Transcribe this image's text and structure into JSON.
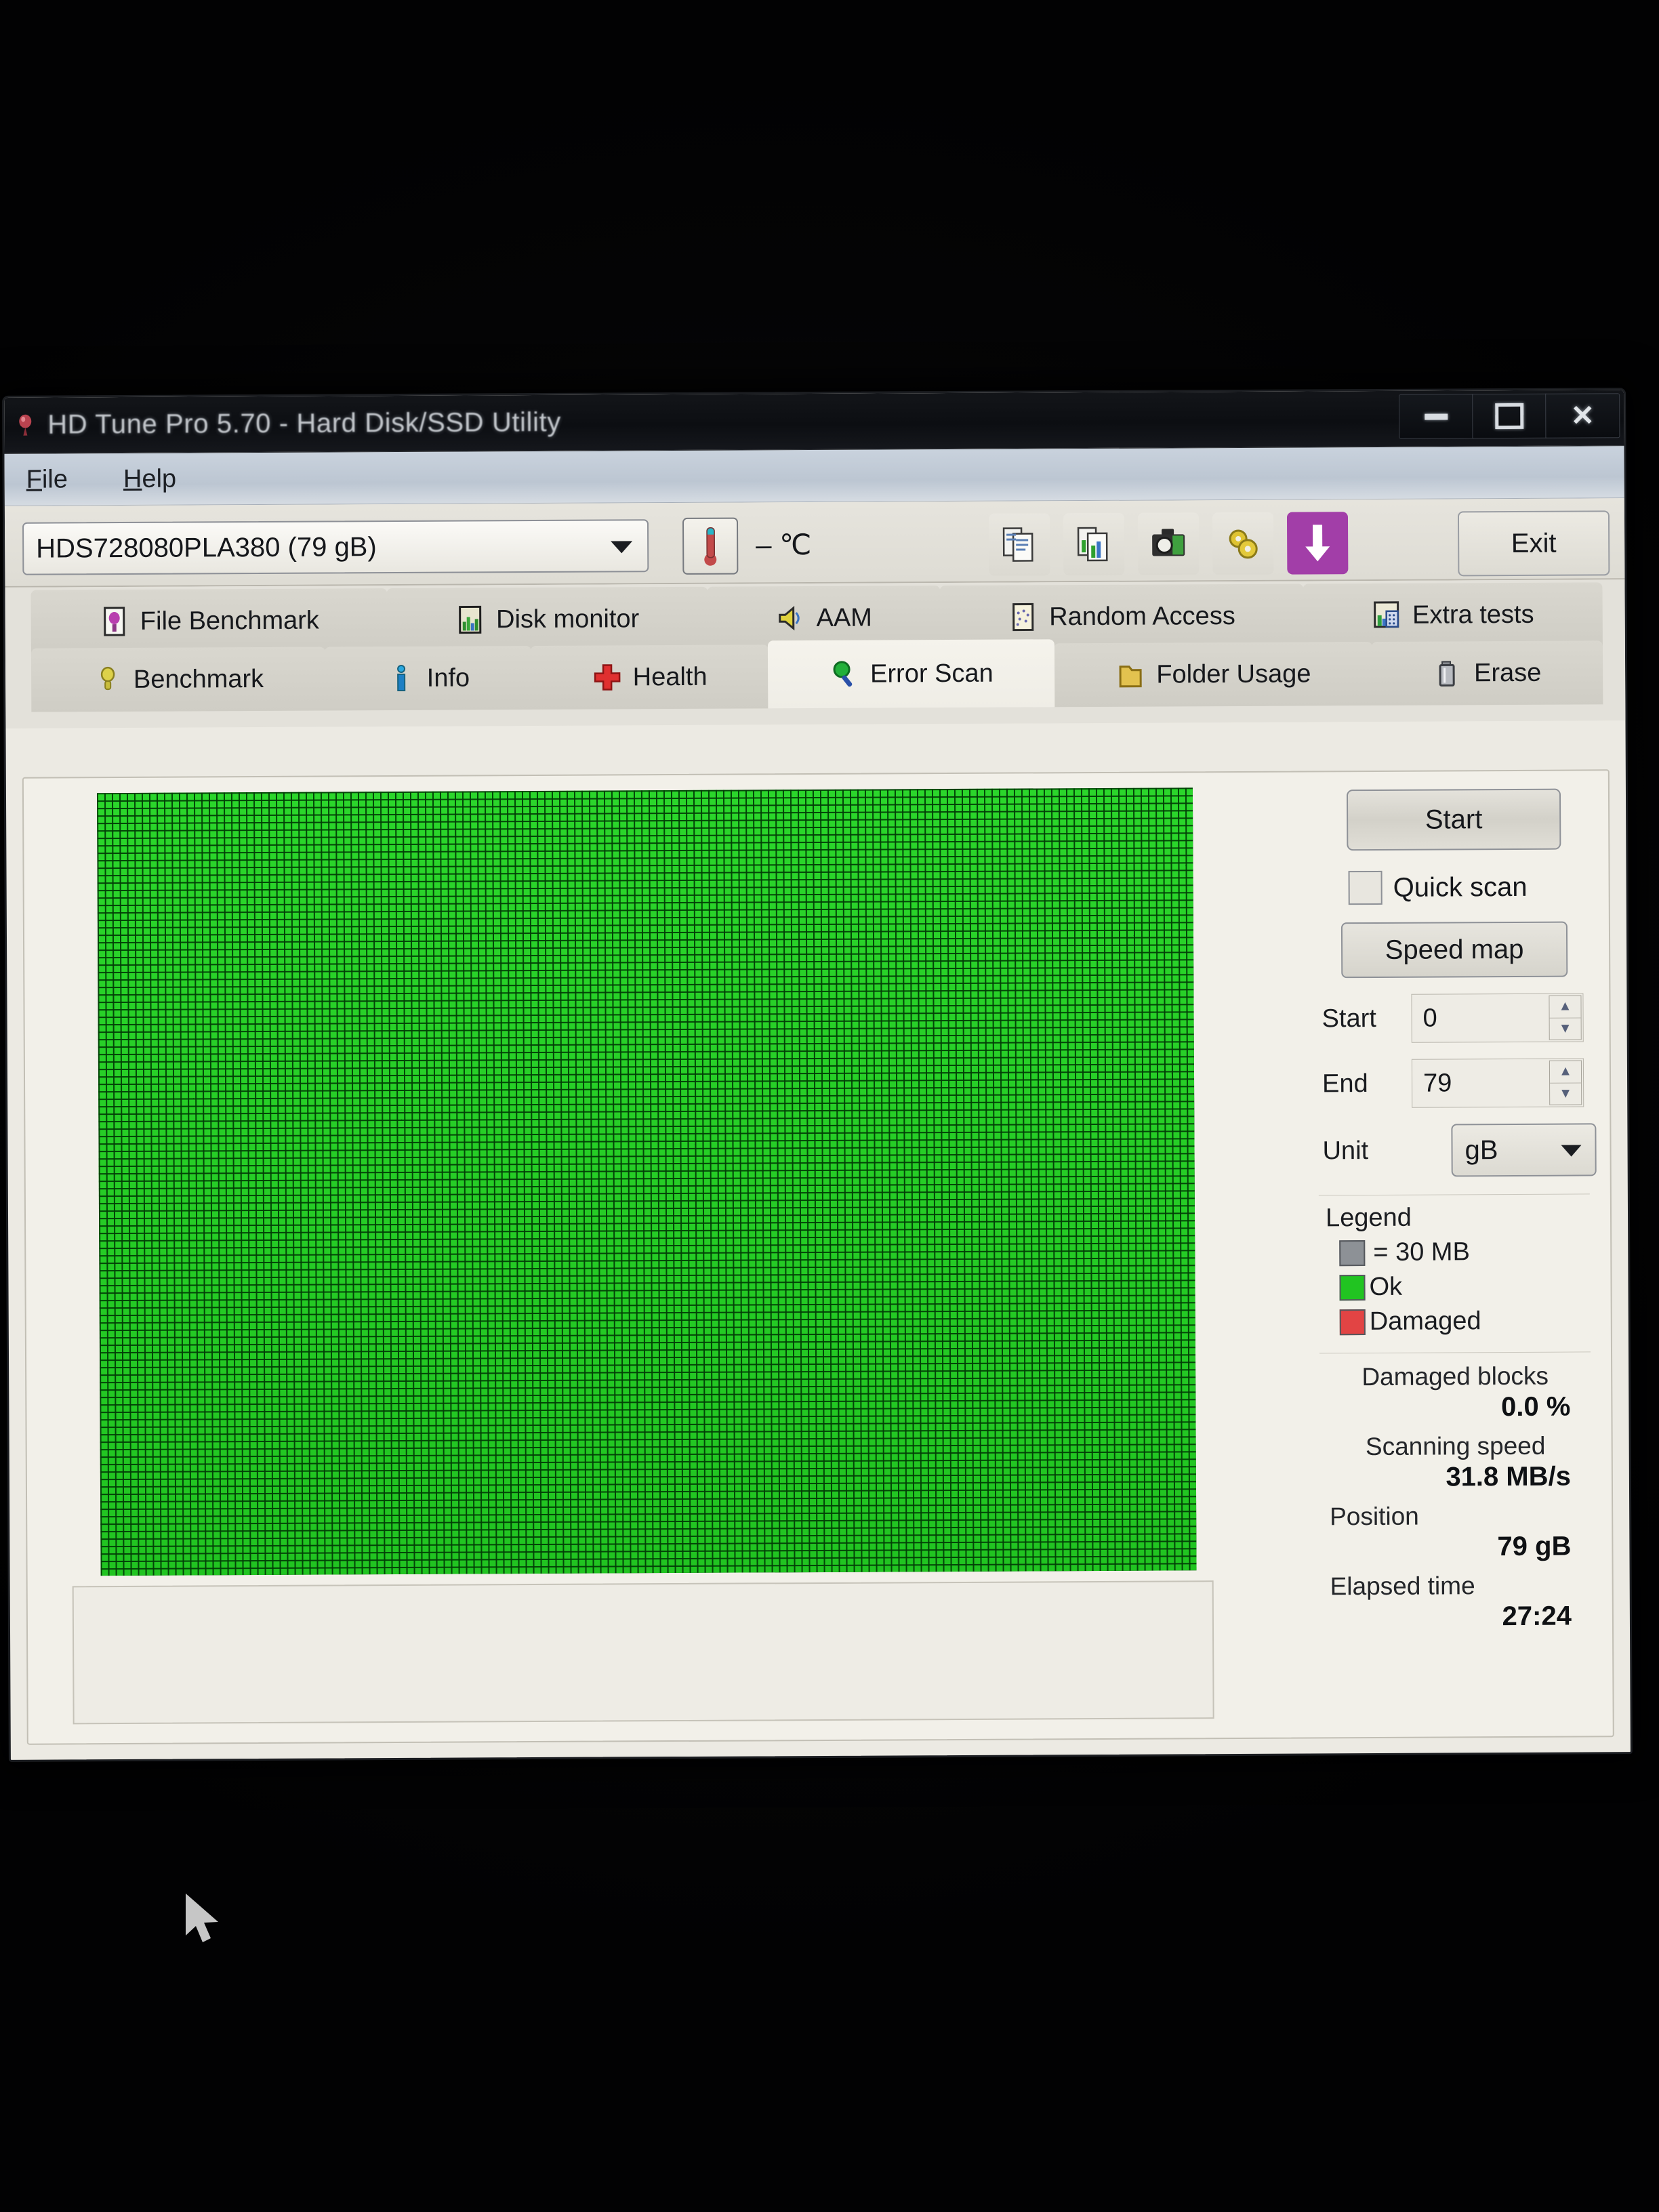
{
  "window": {
    "title": "HD Tune Pro 5.70 - Hard Disk/SSD Utility",
    "title_icon": "hdtune-app-icon",
    "minimize_label": "–",
    "maximize_label": "□",
    "close_label": "✕"
  },
  "menubar": {
    "items": [
      {
        "first": "F",
        "rest": "ile"
      },
      {
        "first": "H",
        "rest": "elp"
      }
    ]
  },
  "toolbar": {
    "drive": "HDS728080PLA380 (79 gB)",
    "temperature": "– ℃",
    "buttons": [
      {
        "name": "copy-text-icon"
      },
      {
        "name": "copy-graph-icon"
      },
      {
        "name": "screenshot-icon"
      },
      {
        "name": "settings-icon"
      },
      {
        "name": "save-icon"
      }
    ],
    "exit_label": "Exit"
  },
  "tabs": {
    "row1": [
      {
        "label": "File Benchmark",
        "icon": "file-benchmark-icon",
        "active": false
      },
      {
        "label": "Disk monitor",
        "icon": "disk-monitor-icon",
        "active": false
      },
      {
        "label": "AAM",
        "icon": "aam-speaker-icon",
        "active": false
      },
      {
        "label": "Random Access",
        "icon": "random-access-icon",
        "active": false
      },
      {
        "label": "Extra tests",
        "icon": "extra-tests-icon",
        "active": false
      }
    ],
    "row2": [
      {
        "label": "Benchmark",
        "icon": "benchmark-icon",
        "active": false
      },
      {
        "label": "Info",
        "icon": "info-icon",
        "active": false
      },
      {
        "label": "Health",
        "icon": "health-cross-icon",
        "active": false
      },
      {
        "label": "Error Scan",
        "icon": "error-scan-magnifier-icon",
        "active": true
      },
      {
        "label": "Folder Usage",
        "icon": "folder-usage-icon",
        "active": false
      },
      {
        "label": "Erase",
        "icon": "erase-trash-icon",
        "active": false
      }
    ]
  },
  "panel": {
    "start_label": "Start",
    "quick_scan_label": "Quick scan",
    "quick_scan_checked": false,
    "speed_map_label": "Speed map",
    "start_field_label": "Start",
    "start_field_value": "0",
    "end_field_label": "End",
    "end_field_value": "79",
    "unit_label": "Unit",
    "unit_value": "gB"
  },
  "legend": {
    "title": "Legend",
    "block_size": "= 30 MB",
    "ok_label": "Ok",
    "damaged_label": "Damaged",
    "block_color": "#8d9196",
    "ok_color": "#21c421",
    "damaged_color": "#e24444"
  },
  "stats": {
    "damaged_blocks_label": "Damaged blocks",
    "damaged_blocks_value": "0.0 %",
    "scanning_speed_label": "Scanning speed",
    "scanning_speed_value": "31.8 MB/s",
    "position_label": "Position",
    "position_value": "79 gB",
    "elapsed_time_label": "Elapsed time",
    "elapsed_time_value": "27:24"
  },
  "blockmap": {
    "all_ok": true,
    "block_color": "#21c421",
    "grid_color": "#023e06"
  }
}
